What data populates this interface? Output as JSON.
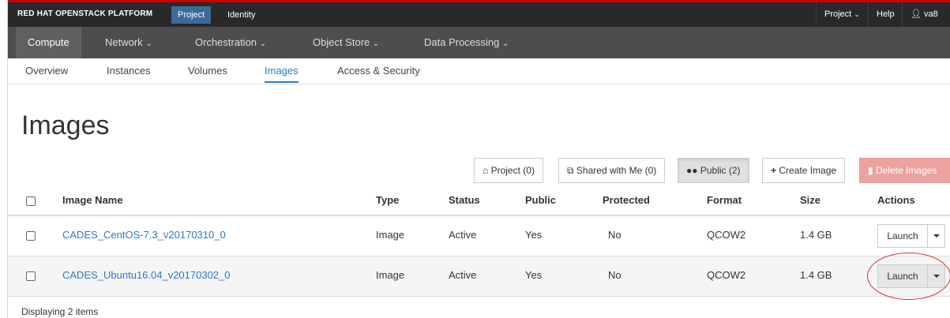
{
  "topbar": {
    "brand": "RED HAT OPENSTACK PLATFORM",
    "tabs": [
      {
        "label": "Project"
      },
      {
        "label": "Identity"
      }
    ],
    "project_menu": "Project",
    "help": "Help",
    "user": "va8"
  },
  "nav": {
    "items": [
      {
        "label": "Compute"
      },
      {
        "label": "Network"
      },
      {
        "label": "Orchestration"
      },
      {
        "label": "Object Store"
      },
      {
        "label": "Data Processing"
      }
    ]
  },
  "subnav": {
    "items": [
      {
        "label": "Overview"
      },
      {
        "label": "Instances"
      },
      {
        "label": "Volumes"
      },
      {
        "label": "Images"
      },
      {
        "label": "Access & Security"
      }
    ]
  },
  "page_title": "Images",
  "filters": {
    "project": "Project (0)",
    "shared": "Shared with Me (0)",
    "public": "Public (2)",
    "create": "Create Image",
    "delete": "Delete Images"
  },
  "table": {
    "headers": {
      "name": "Image Name",
      "type": "Type",
      "status": "Status",
      "public": "Public",
      "protected": "Protected",
      "format": "Format",
      "size": "Size",
      "actions": "Actions"
    },
    "rows": [
      {
        "name": "CADES_CentOS-7.3_v20170310_0",
        "type": "Image",
        "status": "Active",
        "public": "Yes",
        "protected": "No",
        "format": "QCOW2",
        "size": "1.4 GB",
        "action": "Launch"
      },
      {
        "name": "CADES_Ubuntu16.04_v20170302_0",
        "type": "Image",
        "status": "Active",
        "public": "Yes",
        "protected": "No",
        "format": "QCOW2",
        "size": "1.4 GB",
        "action": "Launch"
      }
    ]
  },
  "footer": "Displaying 2 items",
  "colors": {
    "accent": "#2a7abf",
    "danger": "#eca3a0",
    "topbar": "#292929",
    "navbar": "#4d4d4d"
  },
  "icons": [
    "home-icon",
    "share-icon",
    "users-icon",
    "plus-icon",
    "trash-icon",
    "user-icon",
    "chevron-down-icon",
    "caret-down-icon"
  ]
}
